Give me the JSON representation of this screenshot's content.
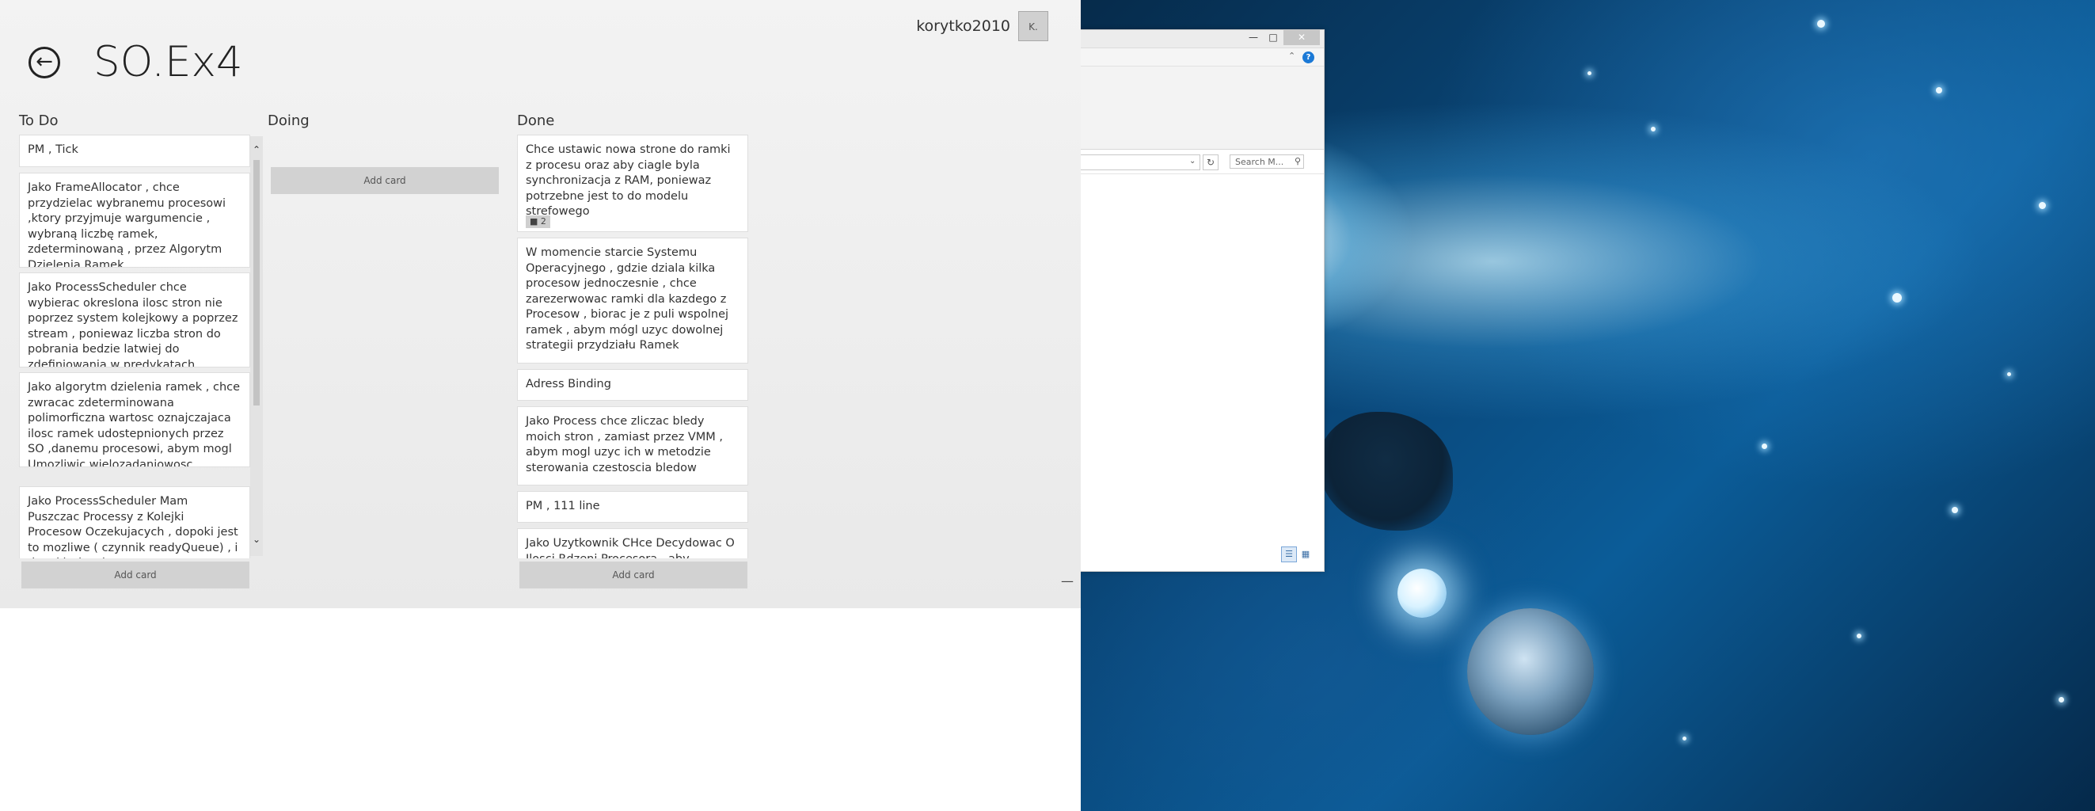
{
  "app": {
    "username": "korytko2010",
    "avatar_initial": "K.",
    "board_title": "SO.Ex4",
    "add_card_label": "Add card"
  },
  "columns": {
    "todo": {
      "title": "To Do",
      "cards": [
        "PM , Tick",
        "Jako FrameAllocator , chce przydzielac wybranemu procesowi ,ktory przyjmuje wargumencie , wybraną liczbę ramek, zdeterminowaną , przez Algorytm Dzielenia Ramek",
        "Jako ProcessScheduler chce wybierac okreslona ilosc stron nie poprzez system kolejkowy a poprzez stream , poniewaz liczba stron do pobrania bedzie latwiej do zdefiniowania w predykatach",
        "Jako algorytm dzielenia ramek , chce zwracac zdeterminowana polimorficzna wartosc oznajczajaca ilosc ramek udostepnionych przez SO ,danemu procesowi, abym mogl Umozliwic wielozadaniowosc",
        "Jako ProcessScheduler Mam Puszczac Processy z Kolejki Procesow Oczekujacych , dopoki jest to mozliwe ( czynnik readyQueue) , i dopoki rdzenie"
      ]
    },
    "doing": {
      "title": "Doing",
      "cards": []
    },
    "done": {
      "title": "Done",
      "cards": [
        "Chce ustawic nowa strone do ramki z procesu oraz aby ciagle byla synchronizacja z RAM, poniewaz potrzebne jest to do modelu strefowego",
        "W momencie starcie Systemu Operacyjnego , gdzie dziala kilka procesow jednoczesnie , chce zarezerwowac ramki dla kazdego z Procesow , biorac je z puli wspolnej ramek , abym mógl uzyc dowolnej strategii przydziału Ramek",
        "Adress Binding",
        "Jako Process chce zliczac bledy moich stron , zamiast przez VMM , abym mogl uzyc ich w metodzie sterowania czestoscia bledow",
        "PM , 111 line",
        "Jako Uzytkownik CHce Decydowac O Ilosci Rdzeni Procesora , aby zapewnic"
      ],
      "first_card_comments": "2"
    }
  },
  "explorer": {
    "search_placeholder": "Search M...",
    "help_label": "?"
  }
}
